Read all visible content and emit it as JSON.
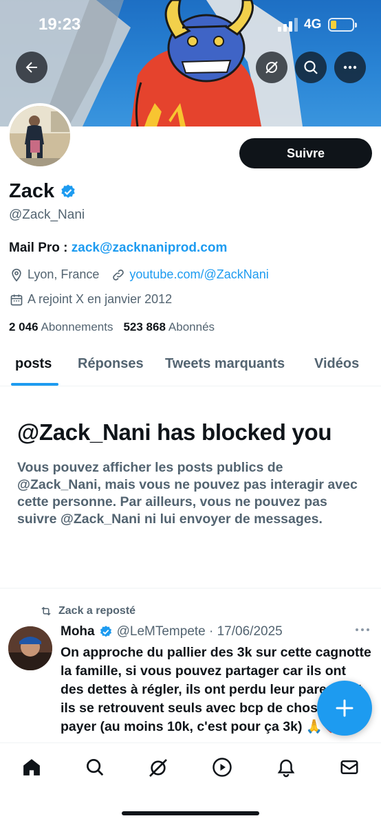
{
  "status_bar": {
    "time": "19:23",
    "network": "4G"
  },
  "profile": {
    "name": "Zack",
    "handle": "@Zack_Nani",
    "follow_label": "Suivre",
    "bio_label": "Mail Pro : ",
    "bio_email": "zack@zacknaniprod.com",
    "location": "Lyon, France",
    "website": "youtube.com/@ZackNani",
    "joined": "A rejoint X en janvier 2012",
    "following_count": "2 046",
    "following_label": "Abonnements",
    "followers_count": "523 868",
    "followers_label": "Abonnés"
  },
  "tabs": [
    {
      "label": "posts",
      "active": true
    },
    {
      "label": "Réponses",
      "active": false
    },
    {
      "label": "Tweets marquants",
      "active": false
    },
    {
      "label": "Vidéos",
      "active": false
    }
  ],
  "blocked": {
    "title": "@Zack_Nani has blocked you",
    "text": "Vous pouvez afficher les posts publics de @Zack_Nani, mais vous ne pouvez pas interagir avec cette personne. Par ailleurs, vous ne pouvez pas suivre @Zack_Nani ni lui envoyer de messages."
  },
  "tweet": {
    "repost_label": "Zack a reposté",
    "author_name": "Moha",
    "author_handle_date": "@LeMTempete · 17/06/2025",
    "text": "On approche du pallier des 3k sur cette cagnotte la famille, si vous pouvez partager car ils ont des dettes à régler, ils ont perdu leur parents et ils se retrouvent seuls avec bcp de choses à payer (au moins 10k, c'est pour ça 3k) 🙏❤️"
  },
  "icons": {
    "back": "arrow-left-icon",
    "grok": "grok-icon",
    "search": "search-icon",
    "more": "more-horizontal-icon",
    "verified": "verified-badge-icon",
    "location": "location-pin-icon",
    "link": "link-icon",
    "calendar": "calendar-icon",
    "repost": "repost-icon",
    "compose": "plus-icon",
    "nav": [
      "home-icon",
      "search-icon",
      "grok-icon",
      "play-icon",
      "bell-icon",
      "mail-icon"
    ]
  },
  "colors": {
    "accent": "#1d9bf0",
    "text": "#0f1419",
    "muted": "#536471"
  }
}
